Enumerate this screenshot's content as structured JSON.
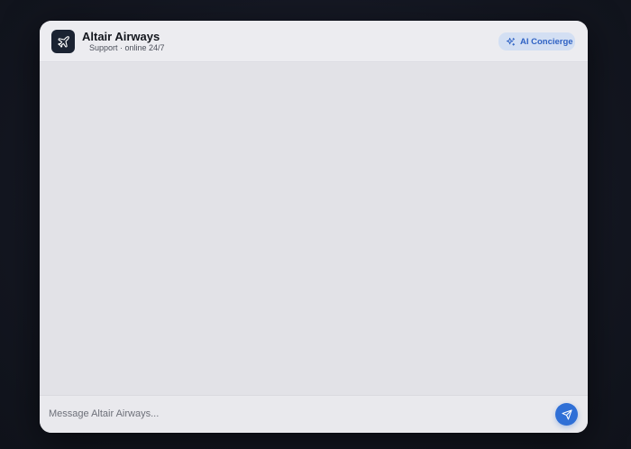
{
  "header": {
    "title": "Altair Airways",
    "subtitle": "Support · online 24/7",
    "logo_icon": "airplane-icon",
    "badge": {
      "label": "AI Concierge",
      "icon": "sparkles-icon",
      "color": "#2f62c4",
      "background": "#d3dff3"
    }
  },
  "composer": {
    "placeholder": "Message Altair Airways...",
    "send_icon": "send-icon",
    "send_color": "#2f6fd6"
  },
  "colors": {
    "backdrop": "#141720",
    "panel": "#e4e4e9",
    "logo_background": "#1b2332"
  }
}
